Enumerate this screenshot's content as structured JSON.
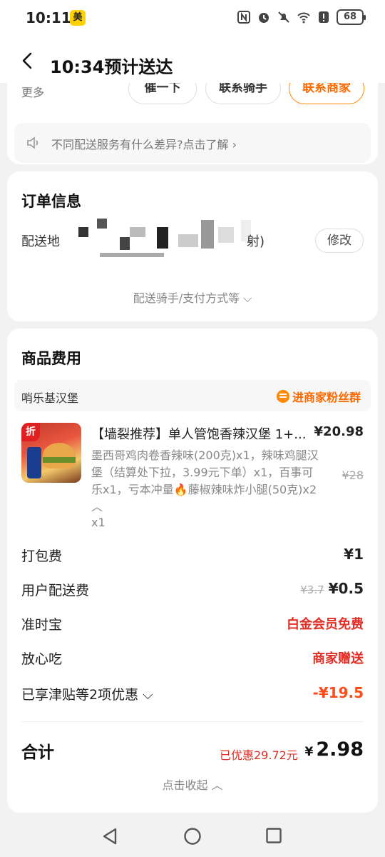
{
  "status": {
    "time": "10:11",
    "app_badge": "美",
    "battery": "68"
  },
  "header": {
    "title": "10:34预计送达"
  },
  "top_card": {
    "more_label": "更多",
    "buttons": [
      "催一下",
      "联系骑手",
      "联系商家"
    ],
    "tip": "不同配送服务有什么差异?点击了解 ›"
  },
  "order": {
    "title": "订单信息",
    "address_label": "配送地",
    "address_visible_suffix": "射)",
    "modify_label": "修改",
    "more_label": "配送骑手/支付方式等 ⌵"
  },
  "goods": {
    "title": "商品费用",
    "shop_name": "哨乐基汉堡",
    "fan_group": "进商家粉丝群",
    "item": {
      "name": "【墙裂推荐】单人管饱香辣汉堡 1+...",
      "price": "¥20.98",
      "desc": "墨西哥鸡肉卷香辣味(200克)x1，辣味鸡腿汉堡（结算处下拉，3.99元下单）x1，百事可乐x1，亏本冲量🔥藤椒辣味炸小腿(50克)x2 ︿",
      "orig_price": "¥28",
      "qty": "x1",
      "thumb_badge": "折"
    },
    "fees": [
      {
        "label": "打包费",
        "value": "¥1"
      },
      {
        "label": "用户配送费",
        "strike": "¥3.7",
        "value": "¥0.5"
      },
      {
        "label": "准时宝",
        "value": "白金会员免费"
      },
      {
        "label": "放心吃",
        "value": "商家赠送"
      },
      {
        "label": "已享津贴等2项优惠 ⌵",
        "value": "-¥19.5"
      }
    ],
    "total_label": "合计",
    "saved": "已优惠29.72元",
    "total_currency": "¥",
    "total": "2.98",
    "collapse": "点击收起 ︿"
  },
  "colors": {
    "accent": "#ff6a00",
    "discount_red": "#e02e24",
    "badge_yellow": "#ffd100"
  }
}
